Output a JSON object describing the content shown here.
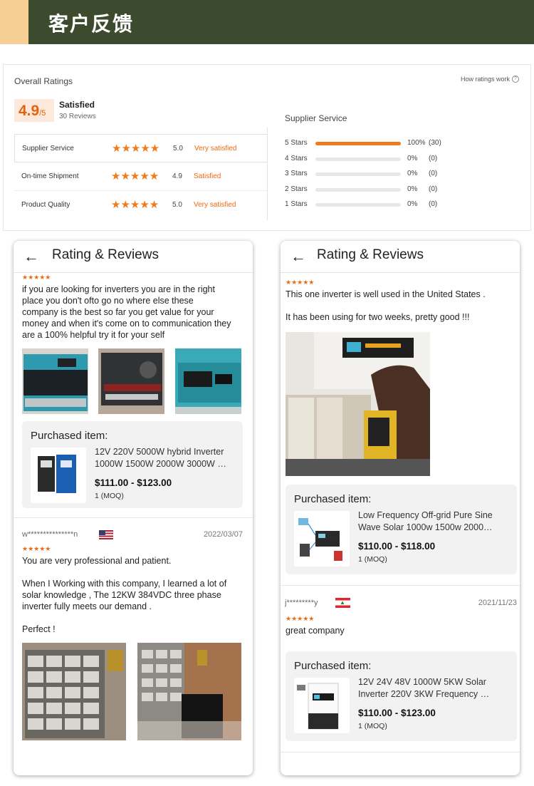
{
  "banner": {
    "title": "客户反馈"
  },
  "ratings": {
    "overall_title": "Overall Ratings",
    "how_link": "How ratings work",
    "score": "4.9",
    "score_max": "/5",
    "satisfaction": "Satisfied",
    "review_count": "30 Reviews",
    "metrics": [
      {
        "label": "Supplier Service",
        "stars": "★★★★★",
        "value": "5.0",
        "text": "Very satisfied"
      },
      {
        "label": "On-time Shipment",
        "stars": "★★★★★",
        "value": "4.9",
        "text": "Satisfied"
      },
      {
        "label": "Product Quality",
        "stars": "★★★★★",
        "value": "5.0",
        "text": "Very satisfied"
      }
    ],
    "supplier_title": "Supplier Service",
    "distribution": [
      {
        "label": "5 Stars",
        "fill": 1.0,
        "pct": "100%",
        "count": "(30)"
      },
      {
        "label": "4 Stars",
        "fill": 0,
        "pct": "0%",
        "count": "(0)"
      },
      {
        "label": "3 Stars",
        "fill": 0,
        "pct": "0%",
        "count": "(0)"
      },
      {
        "label": "2 Stars",
        "fill": 0,
        "pct": "0%",
        "count": "(0)"
      },
      {
        "label": "1 Stars",
        "fill": 0,
        "pct": "0%",
        "count": "(0)"
      }
    ],
    "accent_color": "#f07b1c"
  },
  "left_phone": {
    "title": "Rating & Reviews",
    "review1": {
      "stars": "★★★★★",
      "text": "if you are looking for inverters you are in the right\nplace you don't ofto go no where else  these\ncompany is the best so far you get value for your\nmoney and when it's come on to communication they\nare a 100% helpful try it for your self",
      "card": {
        "title": "Purchased item:",
        "name": "12V 220V 5000W hybrid Inverter 1000W 1500W 2000W 3000W …",
        "price": "$111.00 - $123.00",
        "moq": "1 (MOQ)"
      }
    },
    "review2": {
      "user": "w***************n",
      "date": "2022/03/07",
      "stars": "★★★★★",
      "text": "You are very professional and patient.\n\nWhen  I Working with this company, I learned a lot of\nsolar knowledge ,  The 12KW 384VDC three phase\ninverter fully meets our demand .\n\nPerfect !"
    }
  },
  "right_phone": {
    "title": "Rating & Reviews",
    "review1": {
      "stars": "★★★★★",
      "text": "This one inverter is well used in the United States .\n\nIt has been using  for two weeks, pretty good !!!",
      "card": {
        "title": "Purchased item:",
        "name": "Low Frequency Off-grid Pure Sine Wave Solar 1000w 1500w 2000…",
        "price": "$110.00 - $118.00",
        "moq": "1 (MOQ)"
      }
    },
    "review2": {
      "user": "j*********y",
      "date": "2021/11/23",
      "stars": "★★★★★",
      "text": "great company",
      "card": {
        "title": "Purchased item:",
        "name": "12V 24V 48V 1000W 5KW Solar Inverter 220V 3KW Frequency …",
        "price": "$110.00 - $123.00",
        "moq": "1 (MOQ)"
      }
    }
  }
}
